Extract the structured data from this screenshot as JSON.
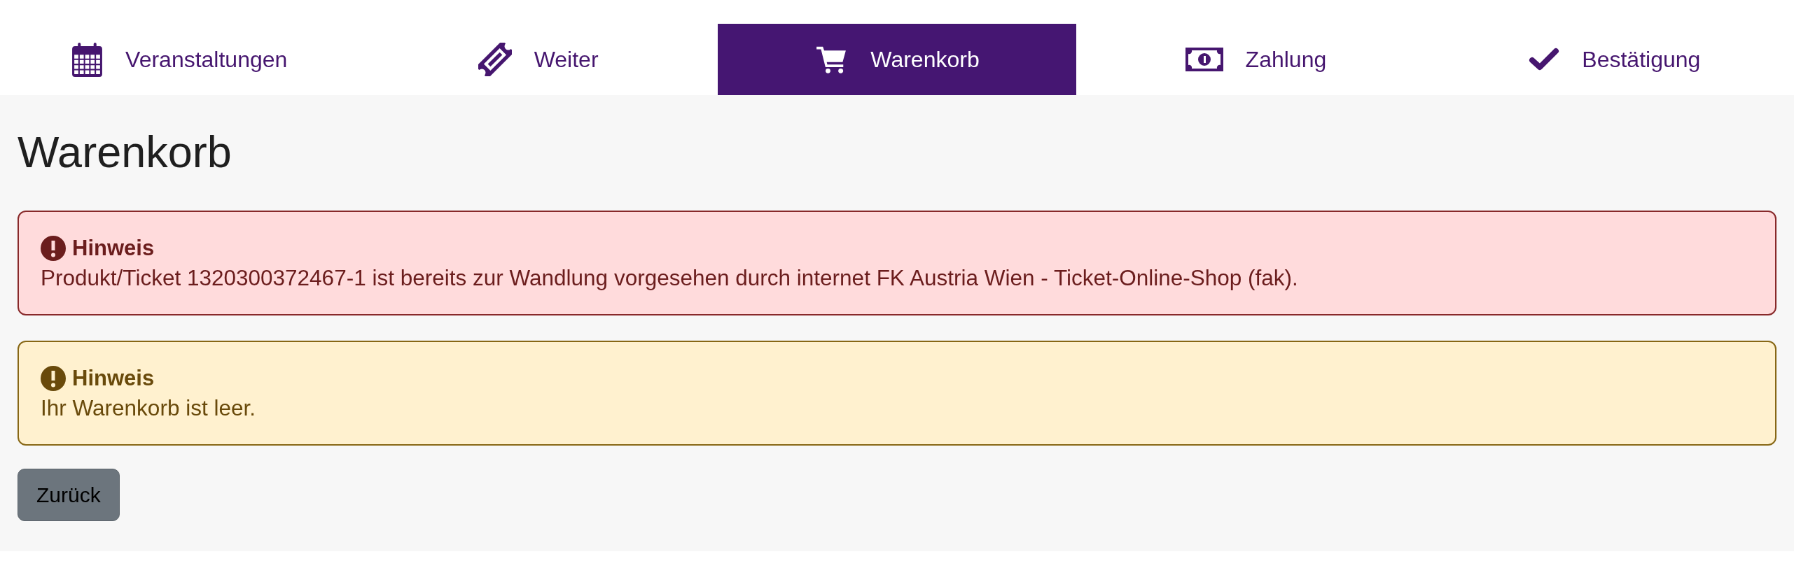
{
  "steps": [
    {
      "label": "Veranstaltungen",
      "selected": false
    },
    {
      "label": "Weiter",
      "selected": false
    },
    {
      "label": "Warenkorb",
      "selected": true
    },
    {
      "label": "Zahlung",
      "selected": false
    },
    {
      "label": "Bestätigung",
      "selected": false
    }
  ],
  "page": {
    "title": "Warenkorb"
  },
  "alerts": [
    {
      "kind": "error",
      "title": "Hinweis",
      "message": "Produkt/Ticket 1320300372467-1 ist bereits zur Wandlung vorgesehen durch internet FK Austria Wien - Ticket-Online-Shop (fak)."
    },
    {
      "kind": "warning",
      "title": "Hinweis",
      "message": "Ihr Warenkorb ist leer."
    }
  ],
  "back_button": {
    "label": "Zurück"
  }
}
